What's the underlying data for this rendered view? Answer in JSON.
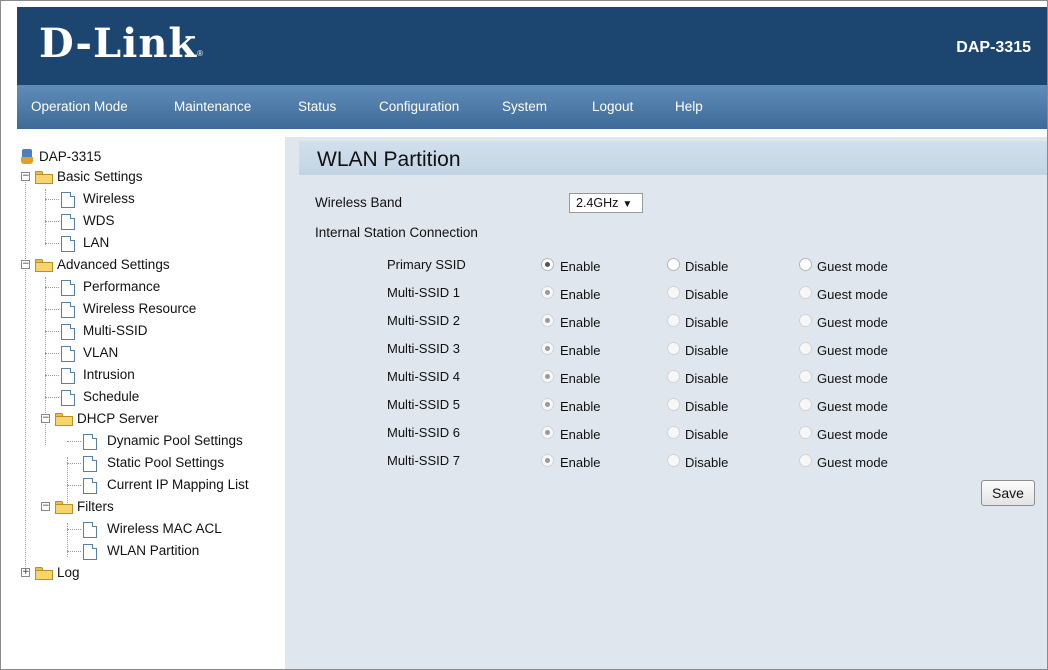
{
  "header": {
    "brand": "D-Link",
    "model": "DAP-3315"
  },
  "nav": [
    "Operation Mode",
    "Maintenance",
    "Status",
    "Configuration",
    "System",
    "Logout",
    "Help"
  ],
  "tree": {
    "root": "DAP-3315",
    "basic": {
      "label": "Basic Settings",
      "items": [
        "Wireless",
        "WDS",
        "LAN"
      ]
    },
    "advanced": {
      "label": "Advanced Settings",
      "items": [
        "Performance",
        "Wireless Resource",
        "Multi-SSID",
        "VLAN",
        "Intrusion",
        "Schedule"
      ]
    },
    "dhcp": {
      "label": "DHCP Server",
      "items": [
        "Dynamic Pool Settings",
        "Static Pool Settings",
        "Current IP Mapping List"
      ]
    },
    "filters": {
      "label": "Filters",
      "items": [
        "Wireless MAC ACL",
        "WLAN Partition"
      ]
    },
    "log": {
      "label": "Log"
    }
  },
  "page": {
    "title": "WLAN Partition",
    "band_label": "Wireless Band",
    "band_value": "2.4GHz",
    "section_label": "Internal Station Connection",
    "options": [
      "Enable",
      "Disable",
      "Guest mode"
    ],
    "rows": [
      {
        "label": "Primary SSID",
        "selected": "Enable"
      },
      {
        "label": "Multi-SSID 1",
        "selected": "Enable"
      },
      {
        "label": "Multi-SSID 2",
        "selected": "Enable"
      },
      {
        "label": "Multi-SSID 3",
        "selected": "Enable"
      },
      {
        "label": "Multi-SSID 4",
        "selected": "Enable"
      },
      {
        "label": "Multi-SSID 5",
        "selected": "Enable"
      },
      {
        "label": "Multi-SSID 6",
        "selected": "Enable"
      },
      {
        "label": "Multi-SSID 7",
        "selected": "Enable"
      }
    ],
    "save_label": "Save"
  }
}
